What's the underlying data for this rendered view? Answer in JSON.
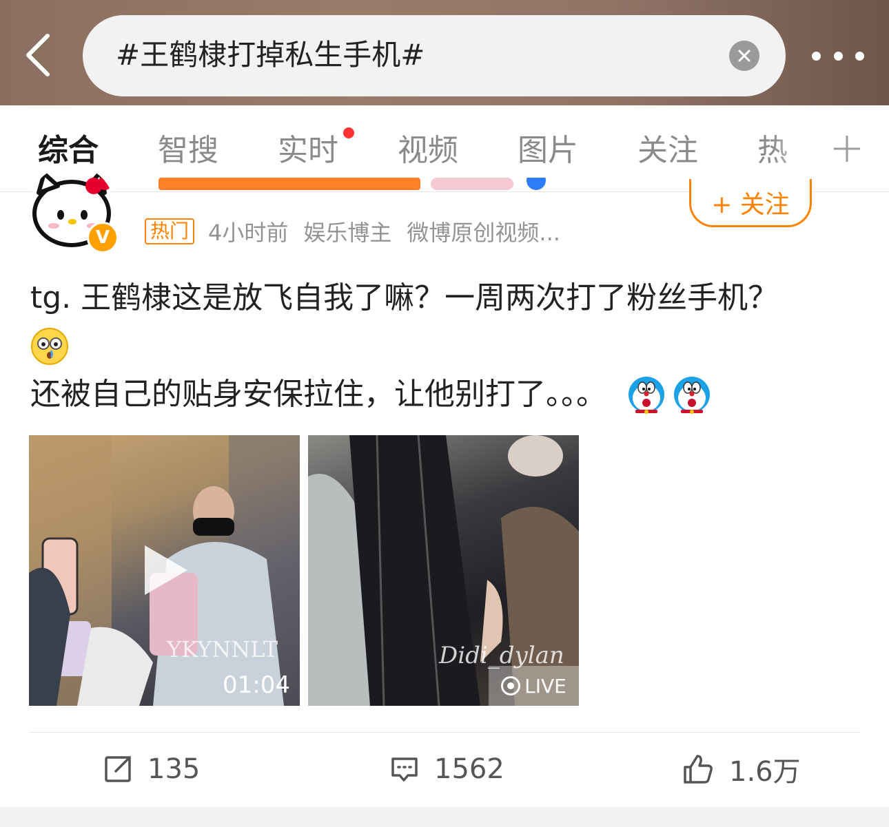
{
  "header": {
    "search_query": "#王鹤棣打掉私生手机#",
    "back_icon": "chevron-left-icon",
    "clear_icon": "close-icon",
    "more_icon": "more-dots-icon"
  },
  "tabs": [
    {
      "label": "综合",
      "active": true
    },
    {
      "label": "智搜"
    },
    {
      "label": "实时",
      "badge": "red-dot"
    },
    {
      "label": "视频"
    },
    {
      "label": "图片"
    },
    {
      "label": "关注"
    },
    {
      "label": "热"
    }
  ],
  "tab_add_icon": "plus-icon",
  "post": {
    "follow_label": "+ 关注",
    "hot_tag": "热门",
    "time": "4小时前",
    "author_type": "娱乐博主",
    "source": "微博原创视频...",
    "text_line1": "tg. 王鹤棣这是放飞自我了嘛？一周两次打了粉丝手机？",
    "text_line3": "还被自己的贴身安保拉住，让他别打了。。。",
    "media": [
      {
        "type": "video",
        "duration": "01:04",
        "watermark": "YKYNNLT"
      },
      {
        "type": "live",
        "badge": "LIVE",
        "watermark": "Didi_dylan"
      }
    ]
  },
  "actions": {
    "repost_count": "135",
    "comment_count": "1562",
    "like_count": "1.6万"
  },
  "colors": {
    "accent": "#ff8200",
    "badge_red": "#ff3333"
  }
}
